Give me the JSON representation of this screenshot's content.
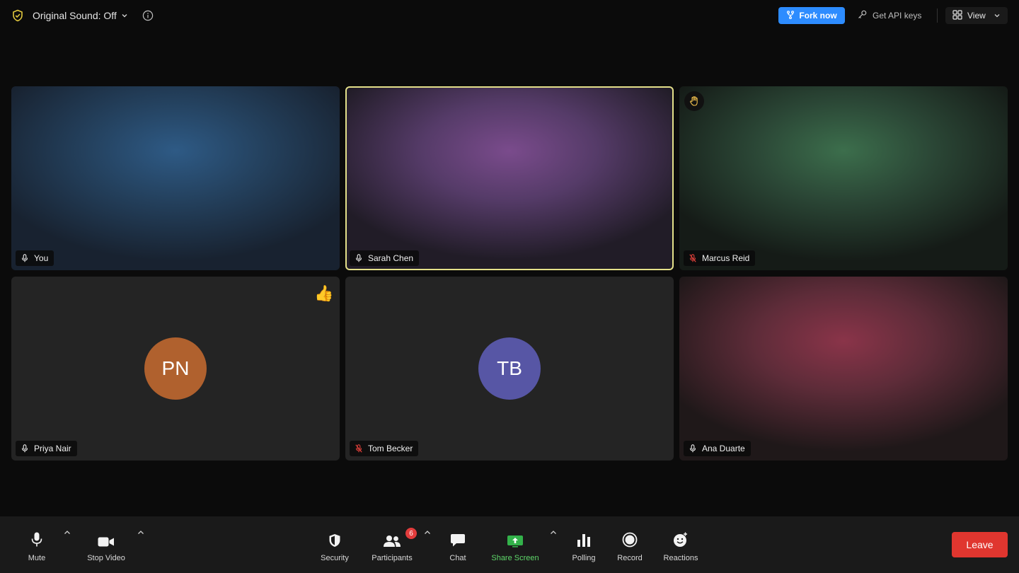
{
  "colors": {
    "accent": "#2d8cff",
    "active_speaker": "#e4e08a",
    "leave": "#e0362f",
    "share": "#5fd86a",
    "badge": "#e23c3c"
  },
  "topbar": {
    "sound_label": "Original Sound: Off",
    "fork_label": "Fork now",
    "api_label": "Get API keys",
    "view_label": "View"
  },
  "tiles": [
    {
      "name": "You",
      "muted": false
    },
    {
      "name": "Sarah Chen",
      "muted": false,
      "active_speaker": true
    },
    {
      "name": "Marcus Reid",
      "muted": true,
      "status": "hand-raised-icon"
    },
    {
      "name": "Priya Nair",
      "muted": false,
      "initials": "PN",
      "avatar_color": "#b0612e",
      "reaction": "👍"
    },
    {
      "name": "Tom Becker",
      "muted": true,
      "initials": "TB",
      "avatar_color": "#5756a5"
    },
    {
      "name": "Ana Duarte",
      "muted": false
    }
  ],
  "toolbar": {
    "mute": "Mute",
    "stop_video": "Stop Video",
    "security": "Security",
    "participants": "Participants",
    "participants_count": "6",
    "chat": "Chat",
    "share_screen": "Share Screen",
    "polling": "Polling",
    "record": "Record",
    "reactions": "Reactions",
    "leave": "Leave"
  }
}
